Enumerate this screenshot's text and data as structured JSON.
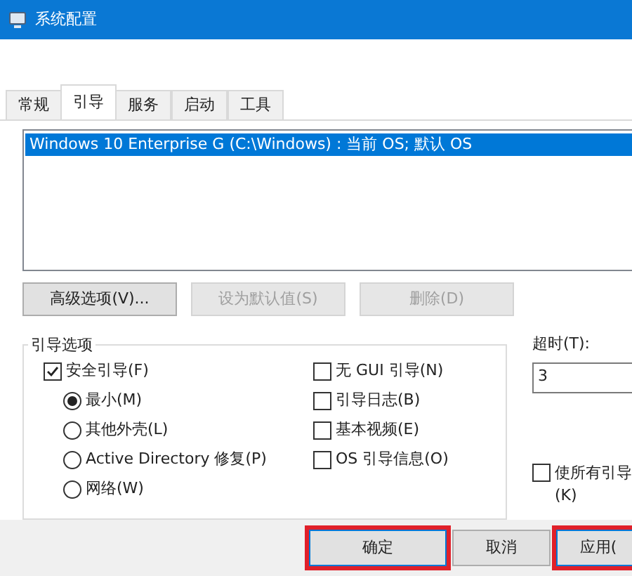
{
  "window": {
    "title": "系统配置"
  },
  "tabs": [
    {
      "label": "常规",
      "selected": false
    },
    {
      "label": "引导",
      "selected": true
    },
    {
      "label": "服务",
      "selected": false
    },
    {
      "label": "启动",
      "selected": false
    },
    {
      "label": "工具",
      "selected": false
    }
  ],
  "boot_list": [
    {
      "label": "Windows 10 Enterprise G (C:\\Windows) : 当前 OS; 默认 OS",
      "selected": true
    }
  ],
  "boot_buttons": [
    {
      "label": "高级选项(V)...",
      "disabled": false
    },
    {
      "label": "设为默认值(S)",
      "disabled": true
    },
    {
      "label": "删除(D)",
      "disabled": true
    }
  ],
  "boot_options": {
    "title": "引导选项",
    "left": [
      {
        "kind": "checkbox",
        "label": "安全引导(F)",
        "checked": true
      },
      {
        "kind": "radio",
        "label": "最小(M)",
        "selected": true
      },
      {
        "kind": "radio",
        "label": "其他外壳(L)",
        "selected": false
      },
      {
        "kind": "radio",
        "label": "Active Directory 修复(P)",
        "selected": false
      },
      {
        "kind": "radio",
        "label": "网络(W)",
        "selected": false
      }
    ],
    "right": [
      {
        "kind": "checkbox",
        "label": "无 GUI 引导(N)",
        "checked": false
      },
      {
        "kind": "checkbox",
        "label": "引导日志(B)",
        "checked": false
      },
      {
        "kind": "checkbox",
        "label": "基本视频(E)",
        "checked": false
      },
      {
        "kind": "checkbox",
        "label": "OS 引导信息(O)",
        "checked": false
      }
    ]
  },
  "timeout": {
    "label": "超时(T):",
    "value": "3"
  },
  "make_permanent": {
    "label": "使所有引导",
    "label_2": "(K)",
    "checked": false
  },
  "footer_buttons": [
    {
      "label": "确定",
      "highlighted": true
    },
    {
      "label": "取消",
      "highlighted": false
    },
    {
      "label": "应用(",
      "highlighted": true
    }
  ]
}
